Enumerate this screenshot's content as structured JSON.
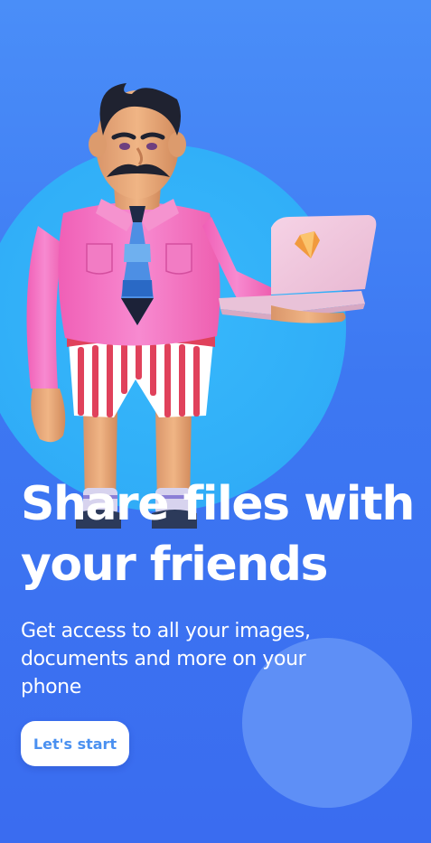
{
  "onboarding": {
    "headline": "Share files with your friends",
    "subtitle": "Get access to all your images, documents and more on your phone",
    "start_button_label": "Let's start"
  },
  "colors": {
    "background": "#3d78f2",
    "circle_large": "#33b1f9",
    "circle_small": "#5e8ff6",
    "button_background": "#ffffff",
    "button_text": "#4a90f0",
    "text": "#ffffff"
  },
  "illustration": {
    "subject": "man-with-laptop-illustration"
  }
}
